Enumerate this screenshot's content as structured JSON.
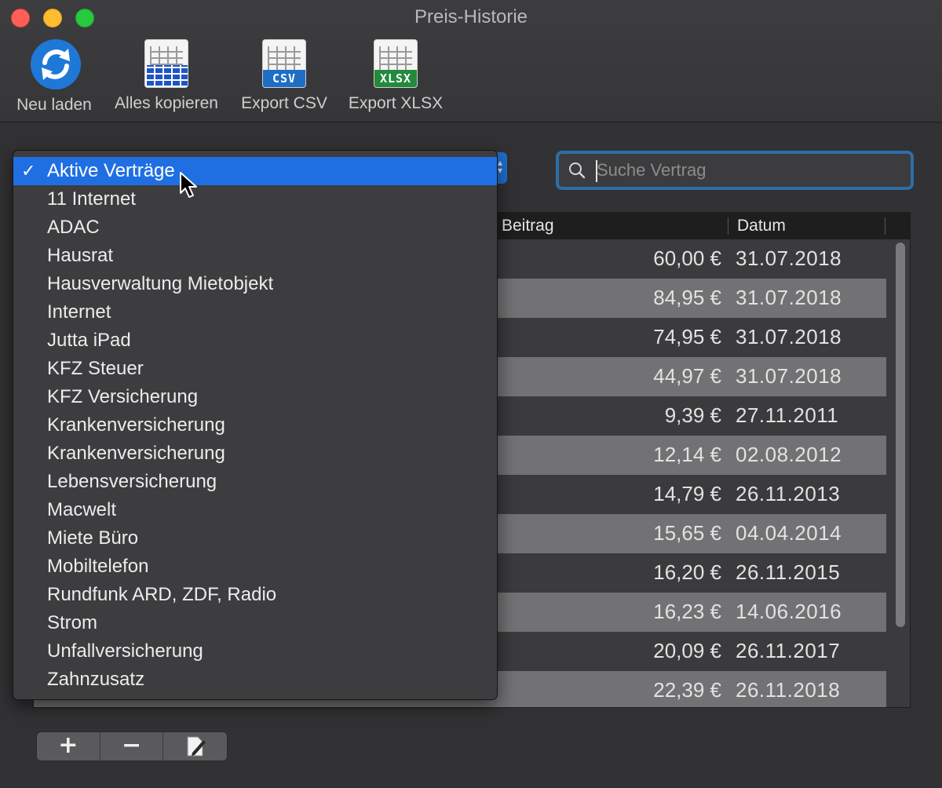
{
  "window": {
    "title": "Preis-Historie"
  },
  "toolbar": {
    "reload_label": "Neu laden",
    "copy_label": "Alles kopieren",
    "csv_label": "Export CSV",
    "csv_badge": "CSV",
    "xlsx_label": "Export XLSX",
    "xlsx_badge": "XLSX"
  },
  "search": {
    "placeholder": "Suche Vertrag",
    "value": ""
  },
  "table": {
    "columns": [
      "Beitrag",
      "Datum"
    ],
    "rows": [
      {
        "amount": "60,00 €",
        "date": "31.07.2018"
      },
      {
        "amount": "84,95 €",
        "date": "31.07.2018"
      },
      {
        "amount": "74,95 €",
        "date": "31.07.2018"
      },
      {
        "amount": "44,97 €",
        "date": "31.07.2018"
      },
      {
        "amount": "9,39 €",
        "date": "27.11.2011"
      },
      {
        "amount": "12,14 €",
        "date": "02.08.2012"
      },
      {
        "amount": "14,79 €",
        "date": "26.11.2013"
      },
      {
        "amount": "15,65 €",
        "date": "04.04.2014"
      },
      {
        "amount": "16,20 €",
        "date": "26.11.2015"
      },
      {
        "amount": "16,23 €",
        "date": "14.06.2016"
      },
      {
        "amount": "20,09 €",
        "date": "26.11.2017"
      },
      {
        "amount": "22,39 €",
        "date": "26.11.2018"
      }
    ]
  },
  "menu": {
    "items": [
      {
        "label": "Aktive Verträge",
        "checked": true
      },
      {
        "label": "11 Internet"
      },
      {
        "label": "ADAC"
      },
      {
        "label": "Hausrat"
      },
      {
        "label": "Hausverwaltung Mietobjekt"
      },
      {
        "label": "Internet"
      },
      {
        "label": "Jutta iPad"
      },
      {
        "label": "KFZ Steuer"
      },
      {
        "label": "KFZ Versicherung"
      },
      {
        "label": "Krankenversicherung"
      },
      {
        "label": "Krankenversicherung"
      },
      {
        "label": "Lebensversicherung"
      },
      {
        "label": "Macwelt"
      },
      {
        "label": "Miete Büro"
      },
      {
        "label": "Mobiltelefon"
      },
      {
        "label": "Rundfunk ARD, ZDF, Radio"
      },
      {
        "label": "Strom"
      },
      {
        "label": "Unfallversicherung"
      },
      {
        "label": "Zahnzusatz"
      }
    ],
    "check_glyph": "✓"
  },
  "buttons": {
    "add": "+",
    "remove": "−"
  },
  "colors": {
    "accent": "#1f6fe3",
    "close": "#fe5f57",
    "minimize": "#febc2e",
    "maximize": "#28c840"
  }
}
